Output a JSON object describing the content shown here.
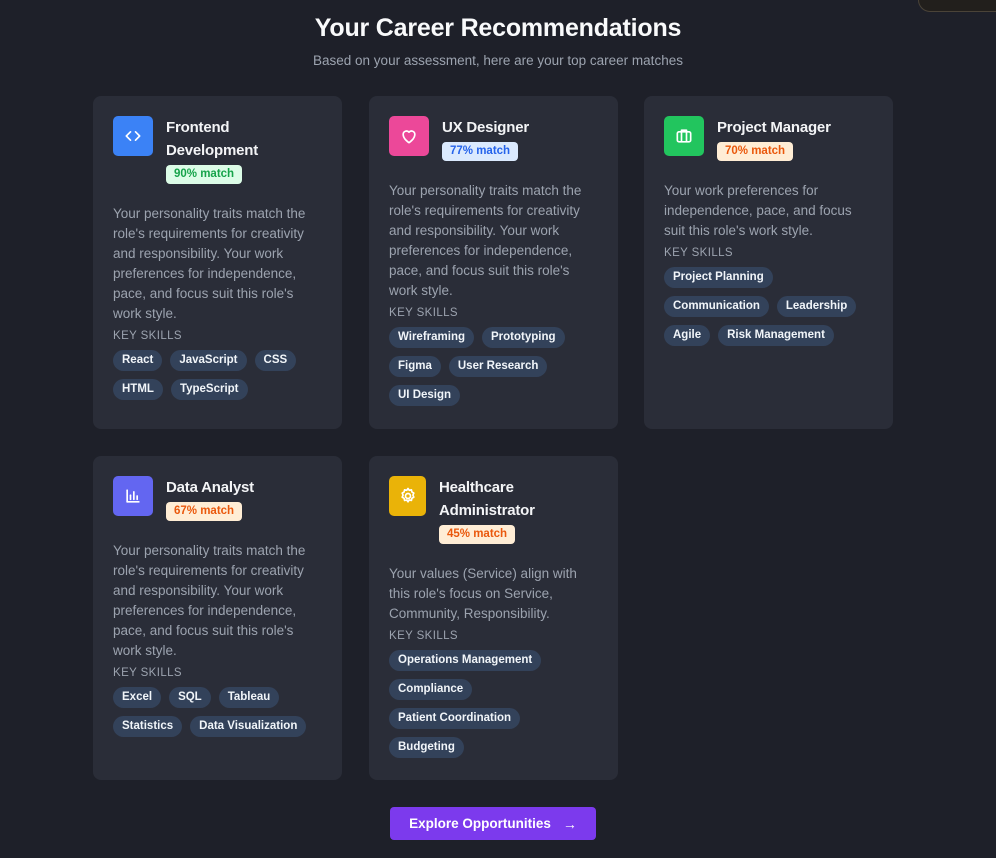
{
  "header": {
    "title": "Your Career Recommendations",
    "subtitle": "Based on your assessment, here are your top career matches"
  },
  "careers": [
    {
      "title": "Frontend Development",
      "match": "90% match",
      "icon": "code-icon",
      "icon_color": "#3b82f6",
      "description": "Your personality traits match the role's requirements for creativity and responsibility. Your work preferences for independence, pace, and focus suit this role's work style.",
      "skills_label": "KEY SKILLS",
      "skills": [
        "React",
        "JavaScript",
        "CSS",
        "HTML",
        "TypeScript"
      ]
    },
    {
      "title": "UX Designer",
      "match": "77% match",
      "icon": "heart-icon",
      "icon_color": "#ec4899",
      "description": "Your personality traits match the role's requirements for creativity and responsibility. Your work preferences for independence, pace, and focus suit this role's work style.",
      "skills_label": "KEY SKILLS",
      "skills": [
        "Wireframing",
        "Prototyping",
        "Figma",
        "User Research",
        "UI Design"
      ]
    },
    {
      "title": "Project Manager",
      "match": "70% match",
      "icon": "briefcase-icon",
      "icon_color": "#22c55e",
      "description": "Your work preferences for independence, pace, and focus suit this role's work style.",
      "skills_label": "KEY SKILLS",
      "skills": [
        "Project Planning",
        "Communication",
        "Leadership",
        "Agile",
        "Risk Management"
      ]
    },
    {
      "title": "Data Analyst",
      "match": "67% match",
      "icon": "bar-chart-icon",
      "icon_color": "#6366f1",
      "description": "Your personality traits match the role's requirements for creativity and responsibility. Your work preferences for independence, pace, and focus suit this role's work style.",
      "skills_label": "KEY SKILLS",
      "skills": [
        "Excel",
        "SQL",
        "Tableau",
        "Statistics",
        "Data Visualization"
      ]
    },
    {
      "title": "Healthcare Administrator",
      "match": "45% match",
      "icon": "gear-icon",
      "icon_color": "#eab308",
      "description": "Your values (Service) align with this role's focus on Service, Community, Responsibility.",
      "skills_label": "KEY SKILLS",
      "skills": [
        "Operations Management",
        "Compliance",
        "Patient Coordination",
        "Budgeting"
      ]
    }
  ],
  "cta": {
    "label": "Explore Opportunities",
    "arrow": "→"
  },
  "colors": {
    "background": "#1e2029",
    "card": "#2a2d38",
    "chip": "#33425a",
    "accent": "#7c3aed"
  }
}
